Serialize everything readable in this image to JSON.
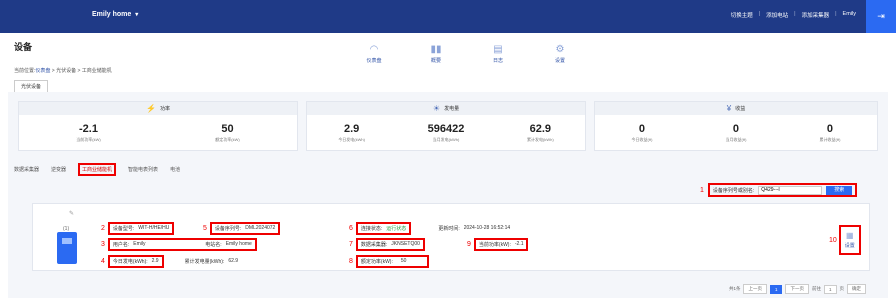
{
  "topbar": {
    "site_name": "Emily home",
    "menu": [
      "切换主题",
      "添加电站",
      "添加采集器",
      "Emily"
    ],
    "exit_icon": "logout-icon"
  },
  "page": {
    "title": "设备",
    "breadcrumb_prefix": "当前位置:",
    "breadcrumb_link": "仪表盘",
    "breadcrumb_rest": " > 光伏设备 > 工商业储能机",
    "main_tab": "光伏设备"
  },
  "nav": [
    {
      "label": "仪表盘",
      "icon": "gauge-icon"
    },
    {
      "label": "概要",
      "icon": "bar-chart-icon"
    },
    {
      "label": "日志",
      "icon": "document-icon"
    },
    {
      "label": "设置",
      "icon": "gear-icon"
    }
  ],
  "cards": {
    "power": {
      "title": "功率",
      "values": [
        {
          "num": "-2.1",
          "lbl": "当前功率(kW)"
        },
        {
          "num": "50",
          "lbl": "额定功率(kW)"
        }
      ]
    },
    "energy": {
      "title": "发电量",
      "values": [
        {
          "num": "2.9",
          "lbl": "今日发电(kWh)"
        },
        {
          "num": "596422",
          "lbl": "当月发电(kWh)"
        },
        {
          "num": "62.9",
          "lbl": "累计发电(kWh)"
        }
      ]
    },
    "revenue": {
      "title": "收益",
      "values": [
        {
          "num": "0",
          "lbl": "今日收益(¥)"
        },
        {
          "num": "0",
          "lbl": "当月收益(¥)"
        },
        {
          "num": "0",
          "lbl": "累计收益(¥)"
        }
      ]
    }
  },
  "subtabs": [
    "数据采集器",
    "逆变器",
    "工商业储能机",
    "智能电表列表",
    "电池"
  ],
  "search": {
    "marker": "1",
    "label": "设备序列号或别名:",
    "value": "Q429---l",
    "button": "搜索"
  },
  "device": {
    "index": "(1)",
    "model": {
      "marker": "2",
      "label": "设备型号:",
      "value": "WIT-H/HE/HU"
    },
    "user": {
      "marker": "3",
      "label": "用户名:",
      "value": "Emily",
      "plant_label": "电站名:",
      "plant_value": "Emily home"
    },
    "today": {
      "marker": "4",
      "label": "今日发电(kWh):",
      "value": "2.9",
      "total_label": "累计发电量(kWh):",
      "total_value": "62.9"
    },
    "serial": {
      "marker": "5",
      "label": "设备序列号:",
      "value": "DML2024072"
    },
    "conn": {
      "marker": "6",
      "label": "连接状态:",
      "value": "运行状态",
      "update_label": "更新时间:",
      "update_value": "2024-10-28 16:52:14"
    },
    "collector": {
      "marker": "7",
      "label": "数据采集器:",
      "value": "JKNSETQ00"
    },
    "rated": {
      "marker": "8",
      "label": "额定功率(kW):",
      "value": "50"
    },
    "curpower": {
      "marker": "9",
      "label": "当前功率(kW):",
      "value": "-2.1"
    },
    "settings": {
      "marker": "10",
      "label": "设置"
    }
  },
  "pager": {
    "total": "共1条",
    "prev": "上一页",
    "page": "1",
    "next": "下一页",
    "goto": "前往",
    "page_input": "1",
    "unit": "页",
    "confirm": "确定"
  }
}
